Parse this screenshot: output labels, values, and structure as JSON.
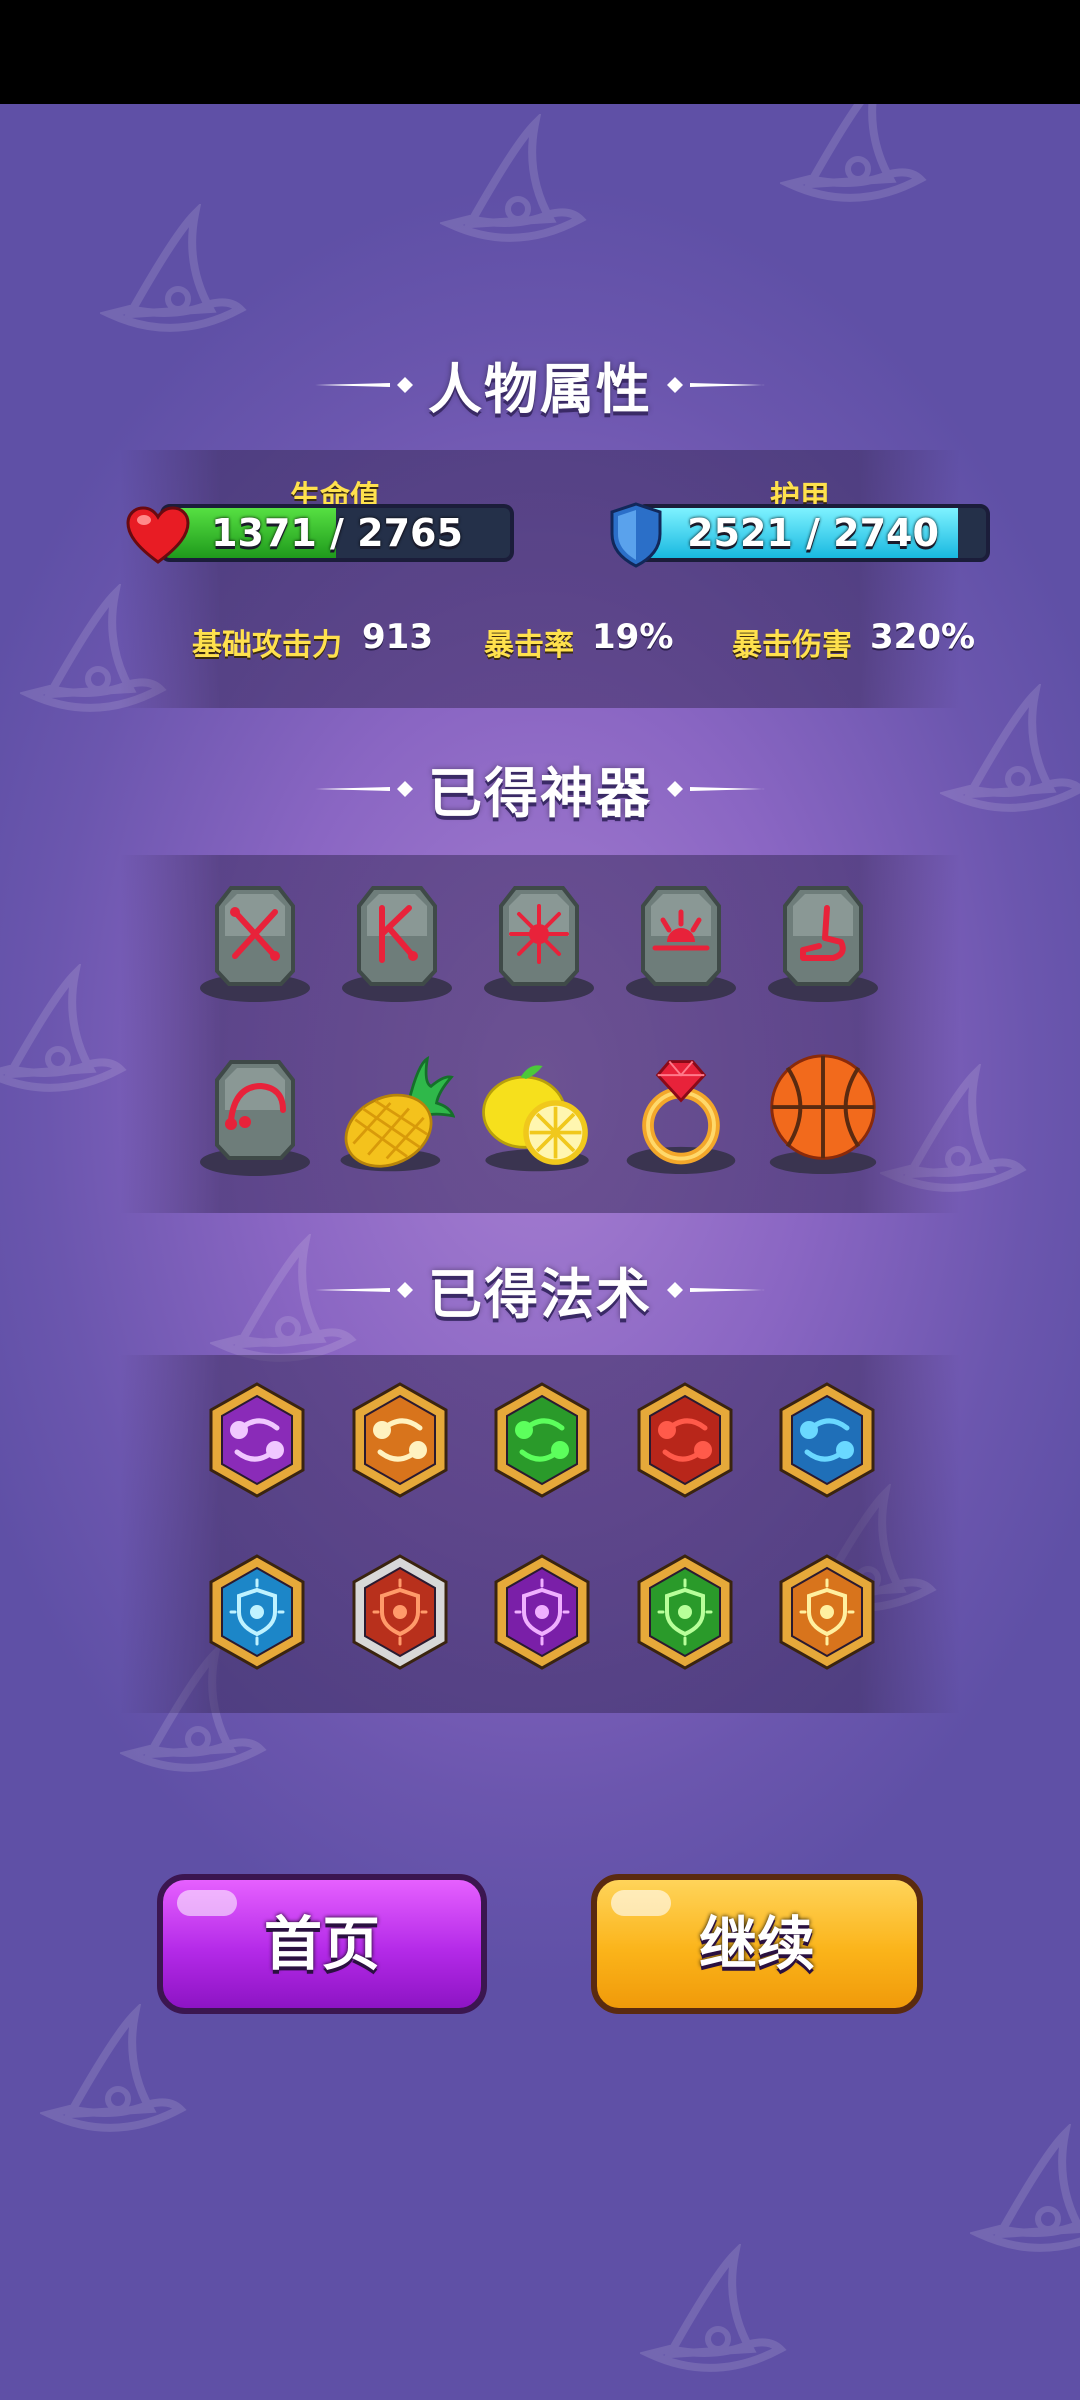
{
  "sections": {
    "attributes_title": "人物属性",
    "artifacts_title": "已得神器",
    "spells_title": "已得法术"
  },
  "health": {
    "label": "生命值",
    "current": 1371,
    "max": 2765,
    "text": "1371 / 2765",
    "color": "#2fbf2a"
  },
  "armor": {
    "label": "护甲",
    "current": 2521,
    "max": 2740,
    "text": "2521 / 2740",
    "color": "#26d4f0"
  },
  "stats": [
    {
      "label": "基础攻击力",
      "value": "913"
    },
    {
      "label": "暴击率",
      "value": "19%"
    },
    {
      "label": "暴击伤害",
      "value": "320%"
    }
  ],
  "artifacts": [
    {
      "name": "rune-stone-cross-icon"
    },
    {
      "name": "rune-stone-k-icon"
    },
    {
      "name": "rune-stone-sun-icon"
    },
    {
      "name": "rune-stone-sunrise-icon"
    },
    {
      "name": "rune-stone-boot-icon"
    },
    {
      "name": "rune-stone-arc-icon"
    },
    {
      "name": "pineapple-icon"
    },
    {
      "name": "lemon-icon"
    },
    {
      "name": "ruby-ring-icon"
    },
    {
      "name": "basketball-icon"
    }
  ],
  "spells": [
    {
      "name": "purple-orbit-spell-icon",
      "frame": "#e6a93a",
      "inner": "#8a2bb8",
      "glyph": "#f0c8ff"
    },
    {
      "name": "orange-orbit-spell-icon",
      "frame": "#e6a93a",
      "inner": "#d8741c",
      "glyph": "#fff2c0"
    },
    {
      "name": "green-orbit-spell-icon",
      "frame": "#e6a93a",
      "inner": "#2a9a2a",
      "glyph": "#5cff5c"
    },
    {
      "name": "red-orbit-spell-icon",
      "frame": "#e6a93a",
      "inner": "#b8261a",
      "glyph": "#ff5a4a"
    },
    {
      "name": "blue-orbit-spell-icon",
      "frame": "#e6a93a",
      "inner": "#1f6fb8",
      "glyph": "#6ad8ff"
    },
    {
      "name": "frost-shield-spell-icon",
      "frame": "#e6a93a",
      "inner": "#1c86c8",
      "glyph": "#bff2ff"
    },
    {
      "name": "fire-shield-spell-icon",
      "frame": "#d8d8d8",
      "inner": "#b8301c",
      "glyph": "#ff9a6a"
    },
    {
      "name": "poison-shield-spell-icon",
      "frame": "#e6a93a",
      "inner": "#7a1fa8",
      "glyph": "#f0b0ff"
    },
    {
      "name": "skull-shield-spell-icon",
      "frame": "#e6a93a",
      "inner": "#2a9a2a",
      "glyph": "#b8ff9a"
    },
    {
      "name": "lightning-shield-spell-icon",
      "frame": "#e6a93a",
      "inner": "#d8741c",
      "glyph": "#fff0a0"
    }
  ],
  "buttons": {
    "home_label": "首页",
    "continue_label": "继续"
  }
}
